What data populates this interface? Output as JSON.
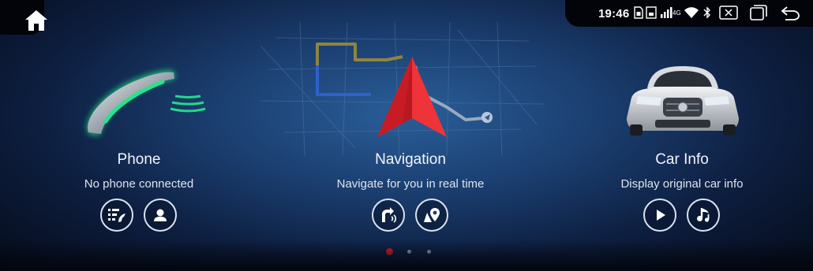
{
  "status_bar": {
    "time": "19:46",
    "network": "4G",
    "icons": [
      "sim-card-icon",
      "screen-mirror-icon",
      "signal-bars-icon",
      "wifi-icon",
      "bluetooth-icon",
      "close-apps-icon",
      "recent-apps-icon",
      "back-icon"
    ]
  },
  "home_button": {
    "icon": "home-icon"
  },
  "apps": [
    {
      "title": "Phone",
      "subtitle": "No phone connected",
      "actions": [
        {
          "icon": "call-log-icon"
        },
        {
          "icon": "contacts-icon"
        }
      ]
    },
    {
      "title": "Navigation",
      "subtitle": "Navigate for you in real time",
      "actions": [
        {
          "icon": "voice-route-icon"
        },
        {
          "icon": "map-location-icon"
        }
      ]
    },
    {
      "title": "Car Info",
      "subtitle": "Display original car info",
      "actions": [
        {
          "icon": "play-icon"
        },
        {
          "icon": "music-icon"
        }
      ]
    }
  ],
  "pager": {
    "pages": 3,
    "current": 1
  },
  "colors": {
    "accent_red": "#e0242b",
    "phone_glow": "#22d98a",
    "background": "#1a3d6e"
  }
}
